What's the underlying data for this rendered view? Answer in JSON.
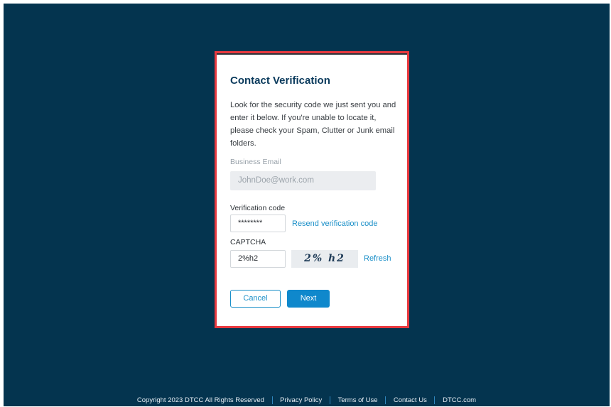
{
  "dialog": {
    "title": "Contact Verification",
    "intro": "Look for the security code we just sent you and enter it below.  If you're unable to locate it, please check your Spam, Clutter or Junk email folders.",
    "email_label": "Business Email",
    "email_value": "JohnDoe@work.com",
    "code_label": "Verification code",
    "code_value": "********",
    "resend_label": "Resend verification code",
    "captcha_label": "CAPTCHA",
    "captcha_value": "2%h2",
    "captcha_image_text": "2% h2",
    "refresh_label": "Refresh",
    "cancel_label": "Cancel",
    "next_label": "Next"
  },
  "footer": {
    "copyright": "Copyright 2023 DTCC All Rights Reserved",
    "links": [
      "Privacy Policy",
      "Terms of Use",
      "Contact Us",
      "DTCC.com"
    ]
  },
  "colors": {
    "background": "#04344f",
    "highlight_border": "#e8393f",
    "accent": "#0f88cc",
    "title": "#0a3a5c"
  }
}
